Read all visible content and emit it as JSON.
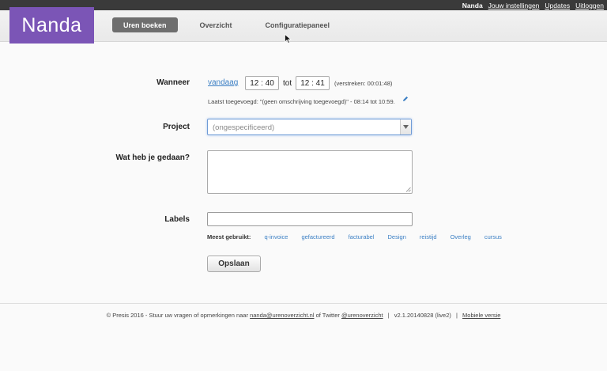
{
  "topbar": {
    "user": "Nanda",
    "links": [
      "Jouw instellingen",
      "Updates",
      "Uitloggen"
    ]
  },
  "logo": "Nanda",
  "nav": {
    "tabs": [
      "Uren boeken",
      "Overzicht",
      "Configuratiepaneel"
    ]
  },
  "form": {
    "wanneer": {
      "label": "Wanneer",
      "date_link": "vandaag",
      "start_time": "12 : 40",
      "sep": "tot",
      "end_time": "12 : 41",
      "elapsed": "(verstreken: 00:01:48)",
      "last_added": "Laatst toegevoegd: \"(geen omschrijving toegevoegd)\" - 08:14 tot 10:59."
    },
    "project": {
      "label": "Project",
      "value": "(ongespecificeerd)"
    },
    "gedaan": {
      "label": "Wat heb je gedaan?"
    },
    "labels": {
      "label": "Labels",
      "most_used": "Meest gebruikt:",
      "tags": [
        "q-invoice",
        "gefactureerd",
        "facturabel",
        "Design",
        "reistijd",
        "Overleg",
        "cursus"
      ]
    },
    "save": "Opslaan"
  },
  "footer": {
    "prefix": "© Presis 2016 - Stuur uw vragen of opmerkingen naar ",
    "email": "nanda@urenoverzicht.nl",
    "middle": " of Twitter ",
    "twitter": "@urenoverzicht",
    "sep": "|",
    "version": "v2.1.20140828 (live2)",
    "mobile": "Mobiele versie"
  },
  "colors": {
    "brand": "#7b55b6",
    "link": "#3b7fc4",
    "topbar": "#3a3a3a"
  }
}
